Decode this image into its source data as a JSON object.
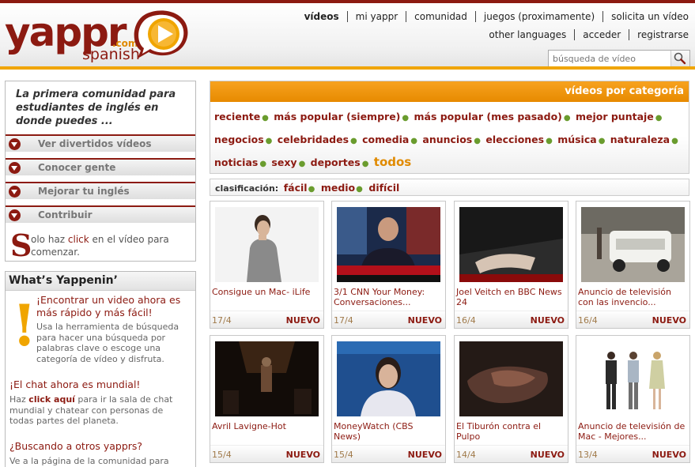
{
  "brand": {
    "name": "yappr",
    "tld": ".com",
    "edition": "spanish",
    "color": "#8c1a11",
    "accent": "#f0a500"
  },
  "nav": {
    "primary": [
      {
        "label": "vídeos",
        "active": true
      },
      {
        "label": "mi yappr"
      },
      {
        "label": "comunidad"
      },
      {
        "label": "juegos (proximamente)"
      },
      {
        "label": "solicita un vídeo"
      }
    ],
    "secondary": [
      {
        "label": "other languages"
      },
      {
        "label": "acceder"
      },
      {
        "label": "registrarse"
      }
    ]
  },
  "search": {
    "placeholder": "búsqueda de vídeo",
    "icon": "search-icon"
  },
  "sidebar": {
    "intro": "La primera comunidad para estudiantes de inglés en donde puedes ...",
    "menu": [
      {
        "label": "Ver divertidos vídeos"
      },
      {
        "label": "Conocer gente"
      },
      {
        "label": "Mejorar tu inglés"
      },
      {
        "label": "Contribuir"
      }
    ],
    "click_note": {
      "initial": "S",
      "text_start": "olo haz ",
      "text_em": "click",
      "text_end": " en el vídeo para comenzar."
    }
  },
  "yappenin": {
    "title": "What’s Yappenin’",
    "h1": "¡Encontrar un video ahora es más rápido y más fácil!",
    "p1": "Usa la herramienta de búsqueda para hacer una búsqueda por palabras clave o escoge una categoría de vídeo y disfruta.",
    "h2": "¡El chat ahora es mundial!",
    "p2_start": "Haz ",
    "p2_link": "click aquí",
    "p2_end": " para ir la sala de chat mundial y chatear con personas de todas partes del planeta.",
    "h3": "¿Buscando a otros yapprs?",
    "p3": "Ve a la página de la comunidad para"
  },
  "categories": {
    "title": "vídeos por categoría",
    "row1": [
      "reciente",
      "más popular (siempre)",
      "más popular (mes pasado)",
      "mejor puntaje"
    ],
    "row2": [
      "negocios",
      "celebridades",
      "comedia",
      "anuncios",
      "elecciones",
      "música",
      "naturaleza"
    ],
    "row3": [
      "noticias",
      "sexy",
      "deportes"
    ],
    "all": "todos"
  },
  "classification": {
    "label": "clasificación:",
    "levels": [
      "fácil",
      "medio",
      "difícil"
    ]
  },
  "videos": [
    {
      "title": "Consigue un Mac- iLife",
      "date": "17/4",
      "badge": "NUEVO"
    },
    {
      "title": "3/1 CNN Your Money: Conversaciones...",
      "date": "17/4",
      "badge": "NUEVO"
    },
    {
      "title": "Joel Veitch en BBC News 24",
      "date": "16/4",
      "badge": "NUEVO"
    },
    {
      "title": "Anuncio de televisión con las invencio...",
      "date": "16/4",
      "badge": "NUEVO"
    },
    {
      "title": "Avril Lavigne-Hot",
      "date": "15/4",
      "badge": "NUEVO"
    },
    {
      "title": "MoneyWatch (CBS News)",
      "date": "15/4",
      "badge": "NUEVO"
    },
    {
      "title": "El Tiburón contra el Pulpo",
      "date": "14/4",
      "badge": "NUEVO"
    },
    {
      "title": "Anuncio de televisión de Mac - Mejores...",
      "date": "13/4",
      "badge": "NUEVO"
    }
  ]
}
